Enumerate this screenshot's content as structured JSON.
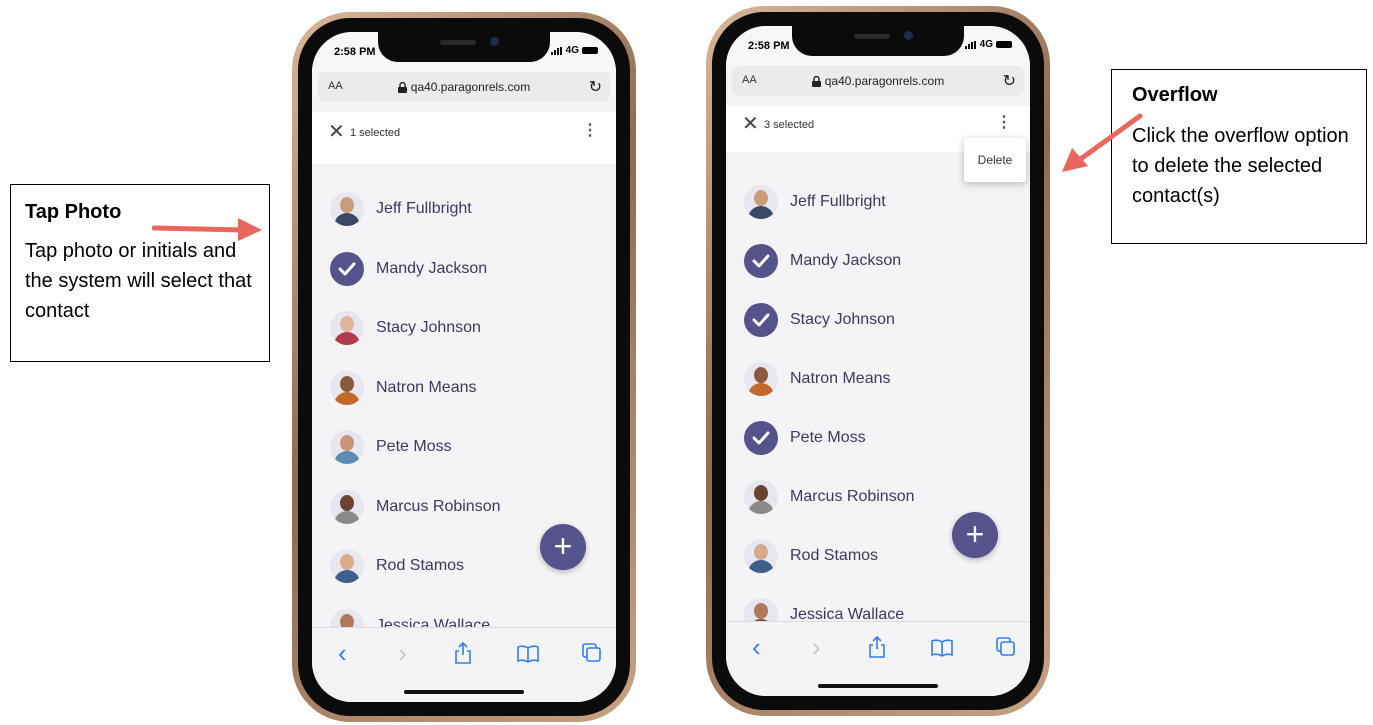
{
  "callouts": {
    "left": {
      "title": "Tap Photo",
      "body": "Tap photo or initials and the system will select that contact"
    },
    "right": {
      "title": "Overflow",
      "body": "Click the overflow option to delete the selected contact(s)"
    }
  },
  "colors": {
    "arrow": "#e9675d",
    "accent": "#55528c",
    "ios_blue": "#2f7ff0"
  },
  "phone1": {
    "time": "2:58 PM",
    "network": "4G",
    "aa": "AA",
    "url": "qa40.paragonrels.com",
    "selected_label": "1 selected",
    "contacts": [
      {
        "name": "Jeff Fullbright",
        "selected": false
      },
      {
        "name": "Mandy Jackson",
        "selected": true
      },
      {
        "name": "Stacy Johnson",
        "selected": false
      },
      {
        "name": "Natron Means",
        "selected": false
      },
      {
        "name": "Pete Moss",
        "selected": false
      },
      {
        "name": "Marcus Robinson",
        "selected": false
      },
      {
        "name": "Rod Stamos",
        "selected": false
      },
      {
        "name": "Jessica Wallace",
        "selected": false
      }
    ],
    "fab": "+"
  },
  "phone2": {
    "time": "2:58 PM",
    "network": "4G",
    "aa": "AA",
    "url": "qa40.paragonrels.com",
    "selected_label": "3 selected",
    "menu_item": "Delete",
    "contacts": [
      {
        "name": "Jeff Fullbright",
        "selected": false
      },
      {
        "name": "Mandy Jackson",
        "selected": true
      },
      {
        "name": "Stacy Johnson",
        "selected": true
      },
      {
        "name": "Natron Means",
        "selected": false
      },
      {
        "name": "Pete Moss",
        "selected": true
      },
      {
        "name": "Marcus Robinson",
        "selected": false
      },
      {
        "name": "Rod Stamos",
        "selected": false
      },
      {
        "name": "Jessica Wallace",
        "selected": false
      }
    ],
    "fab": "+"
  },
  "toolbar": {
    "back": "‹",
    "forward": "›"
  }
}
